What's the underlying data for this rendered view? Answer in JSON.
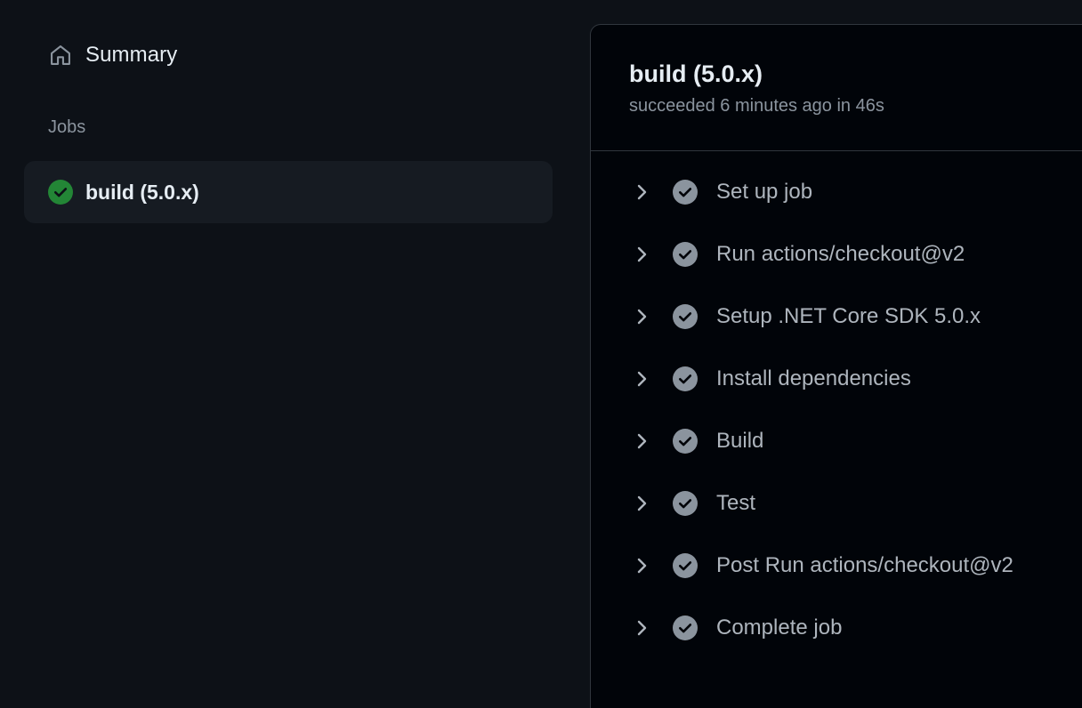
{
  "sidebar": {
    "summary_label": "Summary",
    "summary_icon": "home-icon",
    "jobs_heading": "Jobs",
    "jobs": [
      {
        "label": "build (5.0.x)",
        "status": "success",
        "status_icon": "check-circle-fill-icon"
      }
    ]
  },
  "job": {
    "title": "build (5.0.x)",
    "subtitle": "succeeded 6 minutes ago in 46s",
    "steps": [
      {
        "label": "Set up job"
      },
      {
        "label": "Run actions/checkout@v2"
      },
      {
        "label": "Setup .NET Core SDK 5.0.x"
      },
      {
        "label": "Install dependencies"
      },
      {
        "label": "Build"
      },
      {
        "label": "Test"
      },
      {
        "label": "Post Run actions/checkout@v2"
      },
      {
        "label": "Complete job"
      }
    ]
  },
  "colors": {
    "background": "#0d1117",
    "panel": "#010409",
    "success": "#238636",
    "step_check": "#8b949e",
    "muted_text": "#8b949e"
  }
}
